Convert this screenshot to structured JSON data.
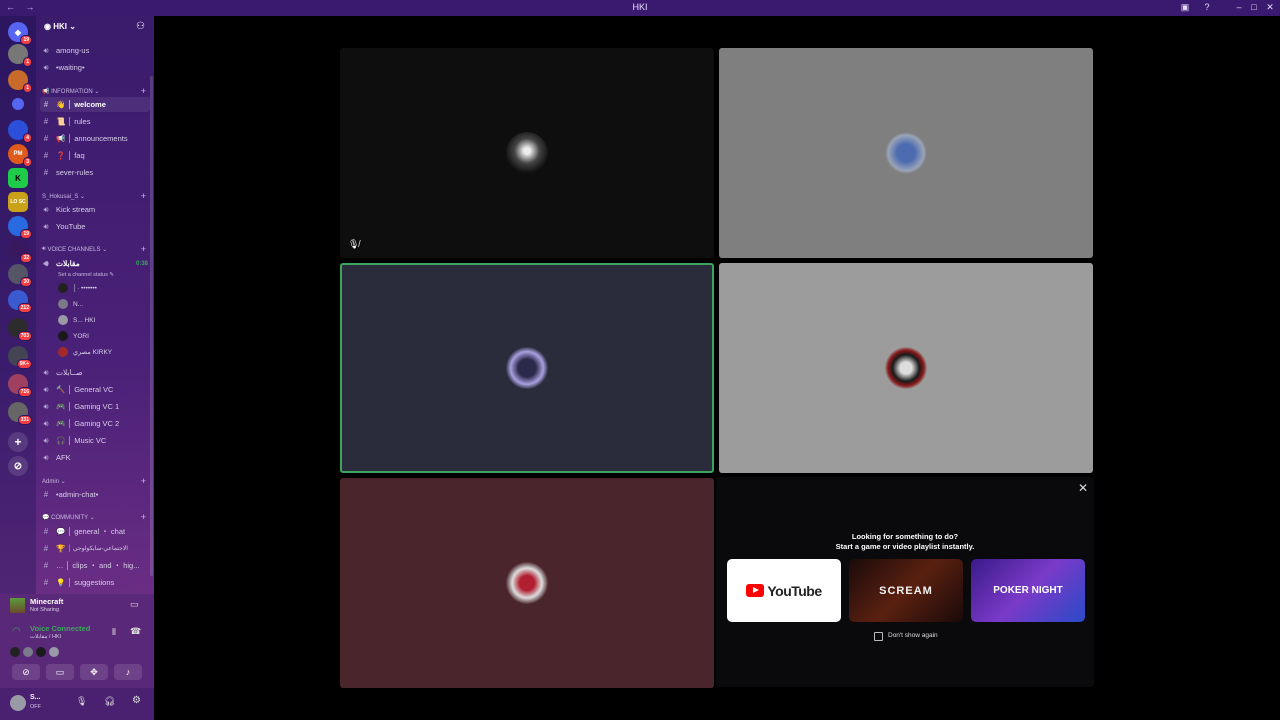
{
  "window": {
    "title": "HKI",
    "nav": "← →"
  },
  "server": {
    "name": "HKI ⌄"
  },
  "channels": {
    "top": [
      "among-us",
      "•waiting•"
    ],
    "information": {
      "label": "INFORMATION ⌄",
      "items": [
        "│ welcome",
        "│ rules",
        "│ announcements",
        "│ faq",
        "sever-rules"
      ]
    },
    "hokusai": {
      "label": "S_Hokusai_S ⌄",
      "items": [
        "Kick stream",
        "YouTube"
      ]
    },
    "voice": {
      "label": "VOICE CHANNELS ⌄",
      "current": "مقابلات",
      "timer": "0:38",
      "status": "Set a channel status ✎",
      "users": [
        "│· •••••••",
        "N...",
        "S...  HKI",
        "YORI",
        "‏مصري  KIRKY"
      ],
      "items": [
        "صــابلات",
        "│ General VC",
        "│ Gaming VC 1",
        "│ Gaming VC 2",
        "│ Music VC",
        "AFK"
      ]
    },
    "admin": {
      "label": "Admin ⌄",
      "items": [
        "•admin-chat•"
      ]
    },
    "community": {
      "label": "COMMUNITY ⌄",
      "items": [
        "│ general ・ chat",
        "│ الاجتماعي-سايكولوجي",
        "│ clips ・ and ・ hig...",
        "│ suggestions"
      ]
    }
  },
  "activity_status": {
    "game": "Minecraft",
    "sub": "Not Sharing"
  },
  "voice_panel": {
    "status": "Voice Connected",
    "channel": "مقابلات / HKI"
  },
  "user": {
    "name": "S...",
    "status": "OFF"
  },
  "rail_badges": [
    "19",
    "1",
    "1",
    "4",
    "",
    "3",
    "",
    "19",
    "32",
    "30",
    "212",
    "703",
    "9K+",
    "716",
    "331"
  ],
  "activity_panel": {
    "heading": "Looking for something to do?",
    "sub": "Start a game or video playlist instantly.",
    "cards": [
      "YouTube",
      "SCREAM",
      "POKER NIGHT"
    ],
    "dont_show": "Don't show again",
    "close": "✕"
  },
  "colors": {
    "speaking_border": "#3ba55d",
    "tile_dark": "#0e0e0e",
    "tile_gray": "#7f7f7f",
    "tile_navy": "#2a2c3c",
    "tile_silver": "#9c9c9c",
    "tile_maroon": "#4a262c"
  }
}
